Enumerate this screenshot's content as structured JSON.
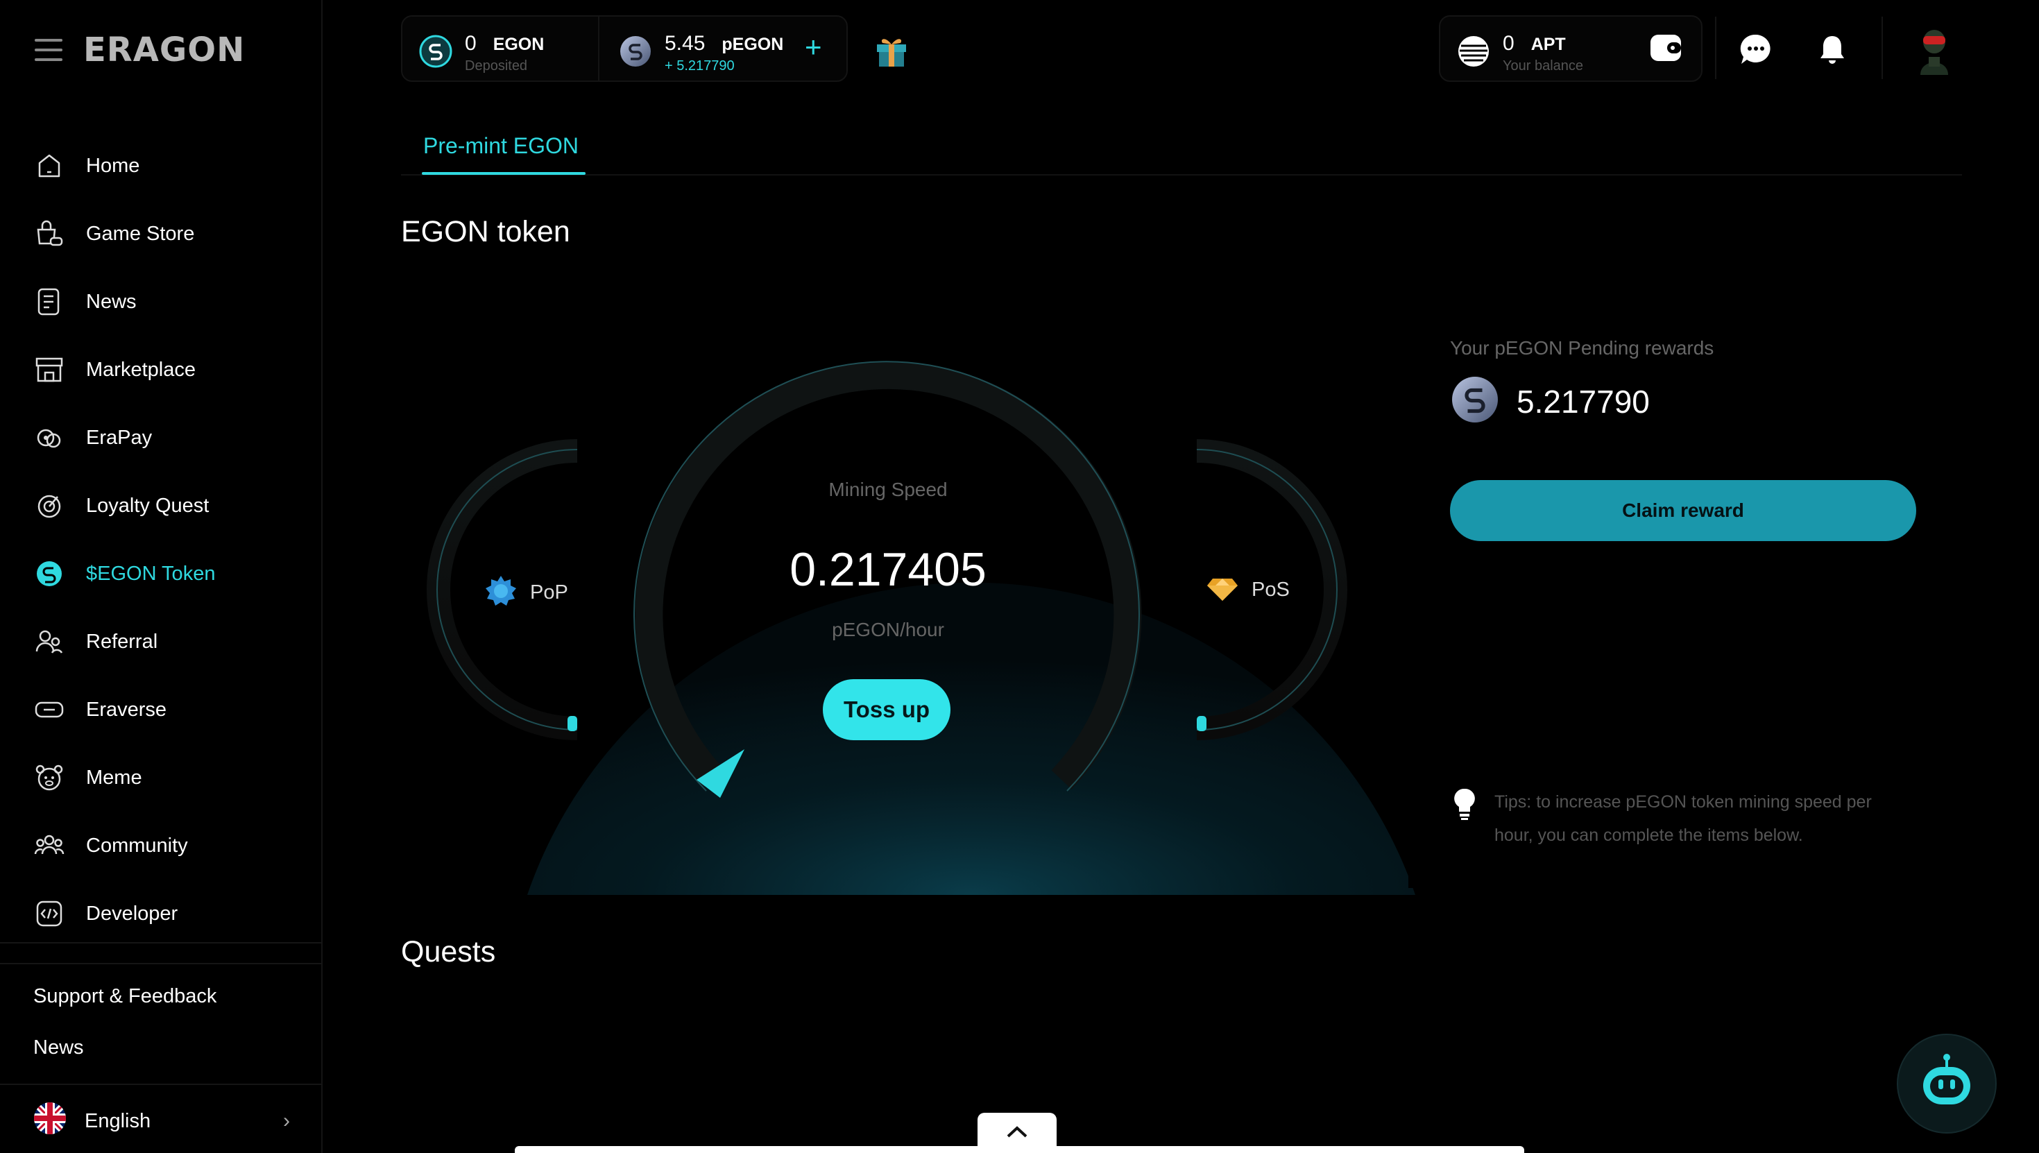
{
  "app": {
    "logo": "ERAGON"
  },
  "sidebar": {
    "items": [
      {
        "label": "Home",
        "icon": "home-icon"
      },
      {
        "label": "Game Store",
        "icon": "game-store-icon"
      },
      {
        "label": "News",
        "icon": "news-icon"
      },
      {
        "label": "Marketplace",
        "icon": "marketplace-icon"
      },
      {
        "label": "EraPay",
        "icon": "erapay-icon"
      },
      {
        "label": "Loyalty Quest",
        "icon": "loyalty-quest-icon"
      },
      {
        "label": "$EGON Token",
        "icon": "egon-token-icon",
        "active": true
      },
      {
        "label": "Referral",
        "icon": "referral-icon"
      },
      {
        "label": "Eraverse",
        "icon": "eraverse-icon"
      },
      {
        "label": "Meme",
        "icon": "meme-icon"
      },
      {
        "label": "Community",
        "icon": "community-icon"
      },
      {
        "label": "Developer",
        "icon": "developer-icon"
      }
    ],
    "support_label": "Support & Feedback",
    "news_label": "News",
    "language": "English"
  },
  "header": {
    "egon": {
      "value": "0",
      "name": "EGON",
      "sub": "Deposited"
    },
    "pegon": {
      "value": "5.45",
      "name": "pEGON",
      "sub": "+ 5.217790"
    },
    "apt": {
      "value": "0",
      "name": "APT",
      "sub": "Your balance"
    }
  },
  "main": {
    "tab": "Pre-mint EGON",
    "section_title": "EGON token",
    "gauge": {
      "label": "Mining Speed",
      "value": "0.217405",
      "unit": "pEGON/hour",
      "toss_label": "Toss up",
      "left_label": "PoP",
      "right_label": "PoS"
    },
    "rewards": {
      "label": "Your pEGON Pending rewards",
      "value": "5.217790",
      "claim_label": "Claim reward"
    },
    "tips": "Tips: to increase pEGON token mining speed per hour, you can complete the items below.",
    "quests_title": "Quests"
  },
  "colors": {
    "accent": "#2fd9e0",
    "claim": "#1a97ab",
    "background": "#000000"
  }
}
